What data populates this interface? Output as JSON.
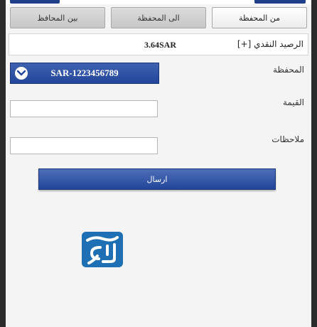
{
  "tabs": [
    {
      "label": "من المحفظة",
      "active": true
    },
    {
      "label": "الى المحفظة",
      "active": false
    },
    {
      "label": "بين المحافظ",
      "active": false
    }
  ],
  "balance": {
    "label": "الرصيد النقدي [+]",
    "value": "3.64SAR"
  },
  "wallet": {
    "label": "المحفظة",
    "selected": "SAR-1223456789"
  },
  "amount": {
    "label": "القيمة",
    "value": "",
    "placeholder": ""
  },
  "notes": {
    "label": "ملاحظات",
    "value": "",
    "placeholder": ""
  },
  "send_label": "ارسال",
  "colors": {
    "accent": "#23459a",
    "background": "#f4f4f4",
    "logo": "#1e6fb3"
  },
  "icons": [
    "chevron-down-icon",
    "brand-logo"
  ]
}
